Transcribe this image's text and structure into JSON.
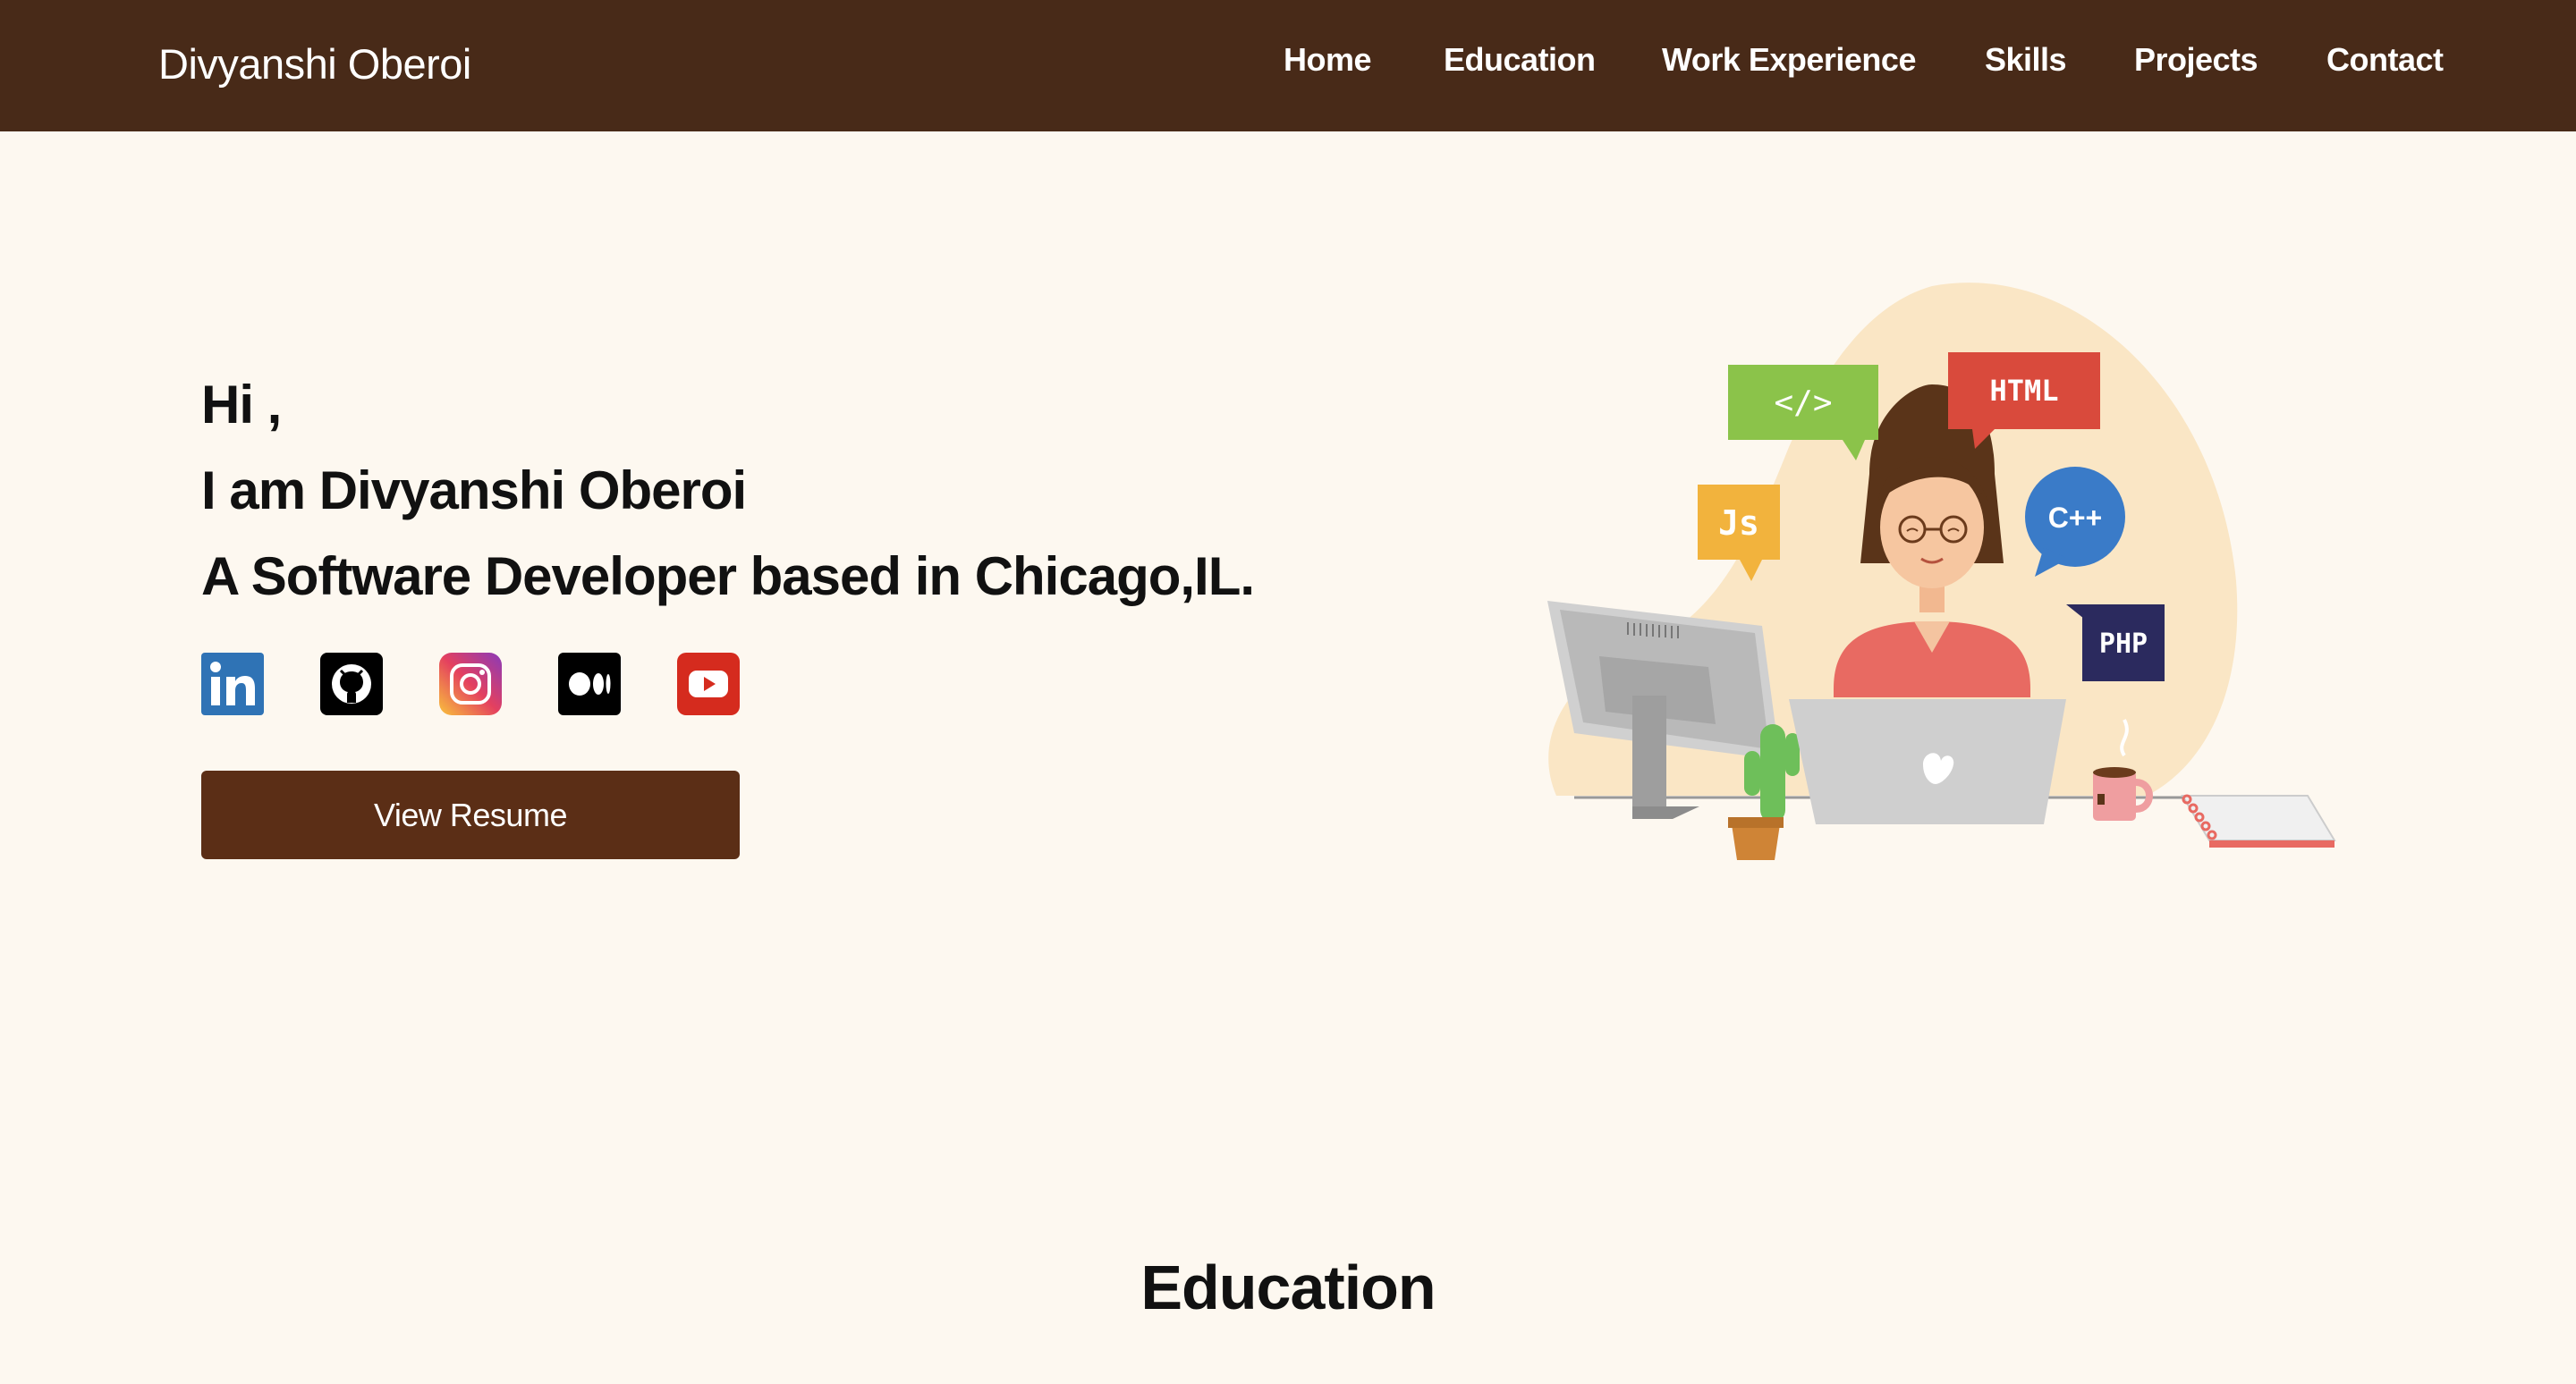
{
  "header": {
    "brand": "Divyanshi Oberoi",
    "nav": [
      {
        "label": "Home"
      },
      {
        "label": "Education"
      },
      {
        "label": "Work Experience"
      },
      {
        "label": "Skills"
      },
      {
        "label": "Projects"
      },
      {
        "label": "Contact"
      }
    ]
  },
  "hero": {
    "greeting": "Hi ,",
    "name_line": "I am Divyanshi Oberoi",
    "tagline": "A Software Developer based in Chicago,IL.",
    "socials": [
      {
        "icon": "linkedin-icon"
      },
      {
        "icon": "github-icon"
      },
      {
        "icon": "instagram-icon"
      },
      {
        "icon": "medium-icon"
      },
      {
        "icon": "youtube-icon"
      }
    ],
    "resume_button": "View Resume",
    "illustration": {
      "bubbles": [
        "</>",
        "HTML",
        "Js",
        "C++",
        "PHP"
      ]
    }
  },
  "sections": {
    "education_title": "Education"
  },
  "colors": {
    "nav_bg": "#482a18",
    "page_bg": "#fdf8f0",
    "button_bg": "#5b2e16"
  }
}
